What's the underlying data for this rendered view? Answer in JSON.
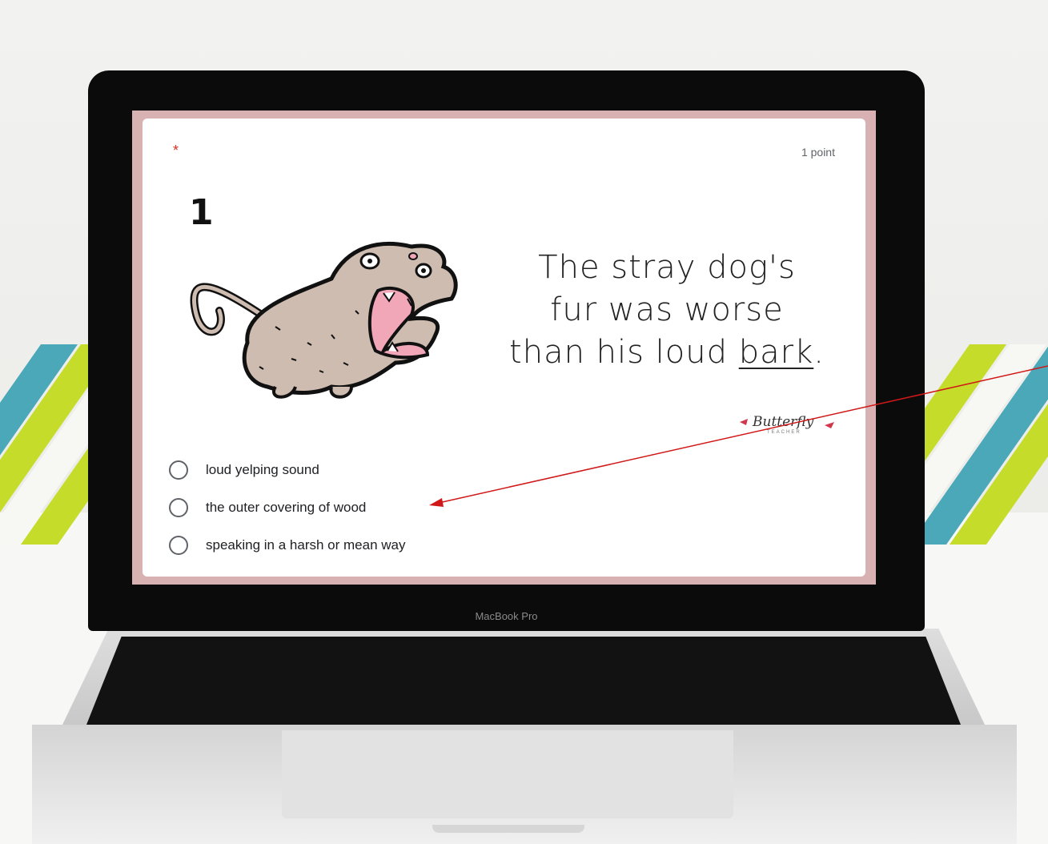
{
  "question": {
    "required_mark": "*",
    "points": "1 point",
    "number": "1",
    "sentence_lines": [
      "The stray dog's",
      "fur was worse",
      "than his loud "
    ],
    "target_word": "bark",
    "sentence_end": "."
  },
  "logo": {
    "text": "Butterfly",
    "subtext": "TEACHER"
  },
  "options": [
    {
      "label": "loud yelping sound",
      "selected": false
    },
    {
      "label": "the outer covering of wood",
      "selected": false
    },
    {
      "label": "speaking in a harsh or mean way",
      "selected": false
    }
  ],
  "device": {
    "label": "MacBook Pro"
  },
  "colors": {
    "screen_border": "#d8b2b2",
    "required": "#d93025",
    "dog_fur": "#cdbcaf",
    "mouth": "#f2a7b8",
    "annotation_arrow": "#d01818",
    "stripe_lime": "#c5dc2a",
    "stripe_teal": "#4aa8b8",
    "stripe_white": "#f7f7f3"
  }
}
